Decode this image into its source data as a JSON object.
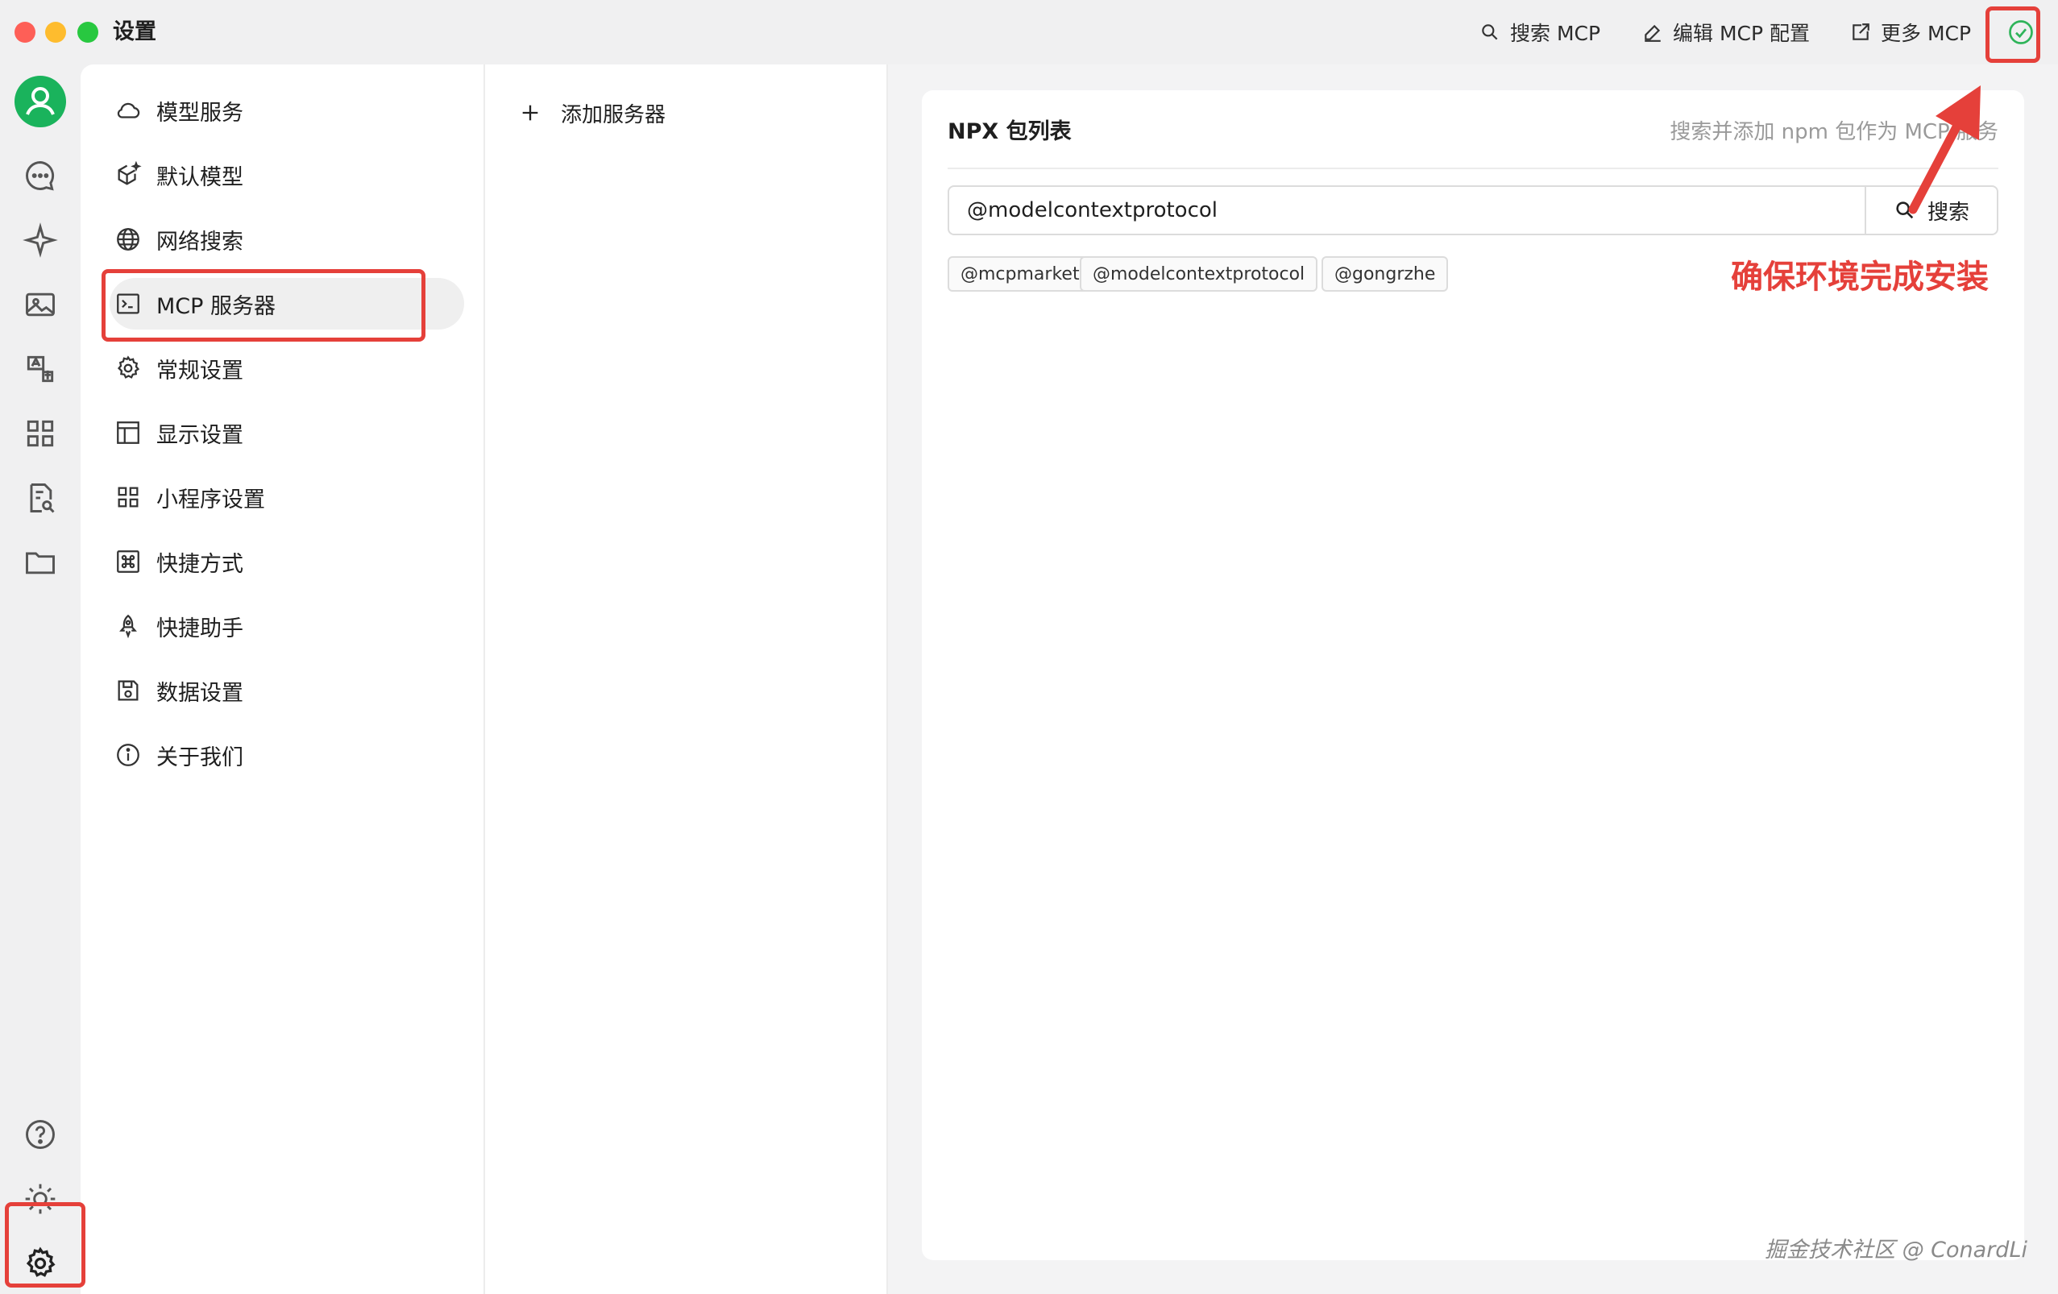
{
  "window": {
    "title": "设置",
    "traffic_lights": [
      "#fe5f57",
      "#febc2e",
      "#28c840"
    ]
  },
  "toolbar": {
    "search_mcp": "搜索 MCP",
    "edit_mcp_config": "编辑 MCP 配置",
    "more_mcp": "更多 MCP",
    "status_icon": "check-circle-icon",
    "status_color": "#2fb45a"
  },
  "rail": {
    "icons": [
      "avatar",
      "chat-bubble-icon",
      "sparkle-icon",
      "image-icon",
      "translate-icon",
      "apps-grid-icon",
      "file-search-icon",
      "folder-icon",
      "help-circle-icon",
      "sun-icon",
      "gear-icon"
    ],
    "avatar_color": "#1ab35c"
  },
  "nav": {
    "items": [
      {
        "label": "模型服务",
        "icon": "cloud-icon"
      },
      {
        "label": "默认模型",
        "icon": "cube-sparkle-icon"
      },
      {
        "label": "网络搜索",
        "icon": "globe-icon"
      },
      {
        "label": "MCP 服务器",
        "icon": "terminal-icon",
        "active": true
      },
      {
        "label": "常规设置",
        "icon": "gear-icon"
      },
      {
        "label": "显示设置",
        "icon": "layout-icon"
      },
      {
        "label": "小程序设置",
        "icon": "grid-icon"
      },
      {
        "label": "快捷方式",
        "icon": "command-key-icon"
      },
      {
        "label": "快捷助手",
        "icon": "rocket-icon"
      },
      {
        "label": "数据设置",
        "icon": "save-icon"
      },
      {
        "label": "关于我们",
        "icon": "info-icon"
      }
    ]
  },
  "servers": {
    "add_label": "添加服务器"
  },
  "npx": {
    "title": "NPX 包列表",
    "hint": "搜索并添加 npm 包作为 MCP 服务",
    "search_value": "@modelcontextprotocol",
    "search_button": "搜索",
    "tags": [
      "@mcpmarket",
      "@modelcontextprotocol",
      "@gongrzhe"
    ]
  },
  "annotation": {
    "note": "确保环境完成安装",
    "color": "#e5403a"
  },
  "watermark": "掘金技术社区 @ ConardLi"
}
